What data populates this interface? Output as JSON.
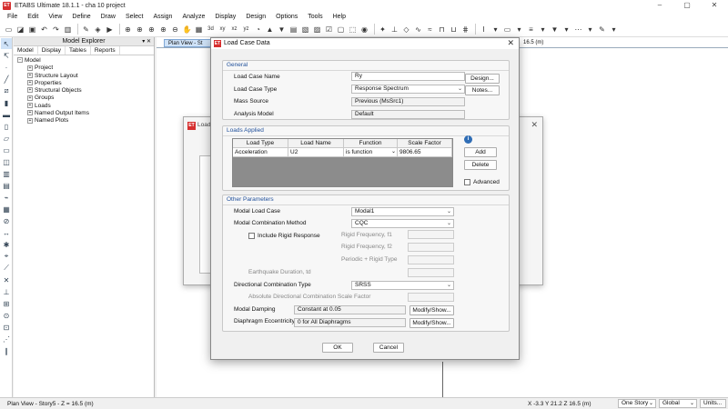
{
  "window": {
    "title": "ETABS Ultimate 18.1.1 - cha 10 project",
    "logo": "ET",
    "minimize": "–",
    "maximize": "▢",
    "close": "✕"
  },
  "menu": [
    "File",
    "Edit",
    "View",
    "Define",
    "Draw",
    "Select",
    "Assign",
    "Analyze",
    "Display",
    "Design",
    "Options",
    "Tools",
    "Help"
  ],
  "explorer": {
    "title": "Model Explorer",
    "tabs": [
      "Model",
      "Display",
      "Tables",
      "Reports"
    ],
    "root": "Model",
    "children": [
      "Project",
      "Structure Layout",
      "Properties",
      "Structural Objects",
      "Groups",
      "Loads",
      "Named Output Items",
      "Named Plots"
    ]
  },
  "view": {
    "plan_tab": "Plan View - St",
    "view3d_tab": "16.5 (m)"
  },
  "bg_dialog": {
    "title": "Load"
  },
  "dialog": {
    "title": "Load Case Data",
    "general": {
      "label": "General",
      "name_label": "Load Case Name",
      "name_value": "Ry",
      "type_label": "Load Case Type",
      "type_value": "Response Spectrum",
      "mass_label": "Mass Source",
      "mass_value": "Previous (MsSrc1)",
      "analysis_label": "Analysis Model",
      "analysis_value": "Default",
      "design_btn": "Design...",
      "notes_btn": "Notes..."
    },
    "loads": {
      "label": "Loads Applied",
      "columns": [
        "Load Type",
        "Load Name",
        "Function",
        "Scale Factor"
      ],
      "row": [
        "Acceleration",
        "U2",
        "is function",
        "9806.65"
      ],
      "add_btn": "Add",
      "delete_btn": "Delete",
      "advanced_label": "Advanced"
    },
    "other": {
      "label": "Other Parameters",
      "modal_case_label": "Modal Load Case",
      "modal_case_value": "Modal1",
      "modal_comb_label": "Modal Combination Method",
      "modal_comb_value": "CQC",
      "rigid_label": "Include Rigid Response",
      "rf1": "Rigid Frequency, f1",
      "rf2": "Rigid Frequency, f2",
      "periodic": "Periodic + Rigid Type",
      "eq_duration": "Earthquake Duration, td",
      "dir_comb_label": "Directional Combination Type",
      "dir_comb_value": "SRSS",
      "abs_dir": "Absolute Directional Combination Scale Factor",
      "damping_label": "Modal Damping",
      "damping_value": "Constant at 0.05",
      "ecc_label": "Diaphragm Eccentricity",
      "ecc_value": "0 for All Diaphragms",
      "modify_btn": "Modify/Show..."
    },
    "ok": "OK",
    "cancel": "Cancel"
  },
  "status": {
    "left": "Plan View - Story5 - Z = 16.5 (m)",
    "coords": "X -3.3  Y 21.2  Z 16.5 (m)",
    "story": "One Story",
    "coord_sys": "Global",
    "units": "Units..."
  }
}
